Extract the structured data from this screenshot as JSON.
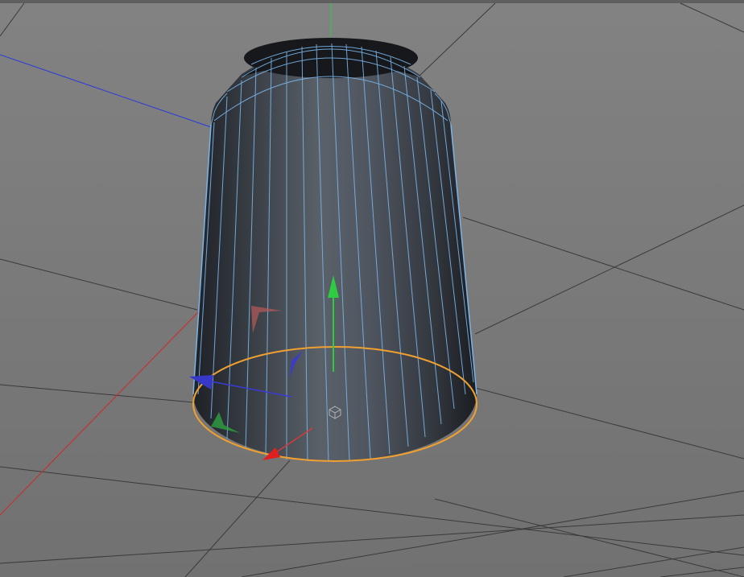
{
  "viewport": {
    "mode": "perspective-3d-editor",
    "background_color": "#7b7b7b",
    "grid_color": "#3a3a3a",
    "selection_outline_color": "#f0a030",
    "wireframe_color": "#7ab4e8"
  },
  "object": {
    "type": "cylinder",
    "selected": true,
    "edge_highlight": "selected-bottom-cap"
  },
  "axes": {
    "world_x_color": "#d43a3a",
    "world_y_color": "#2ecc40",
    "world_z_color": "#3a3ad4"
  },
  "gizmo": {
    "type": "move-tool",
    "icons": [
      "y-arrow-icon",
      "x-arrow-icon",
      "z-arrow-icon",
      "xy-plane-handle-icon",
      "yz-plane-handle-icon",
      "xz-plane-handle-icon",
      "pivot-icon"
    ]
  }
}
